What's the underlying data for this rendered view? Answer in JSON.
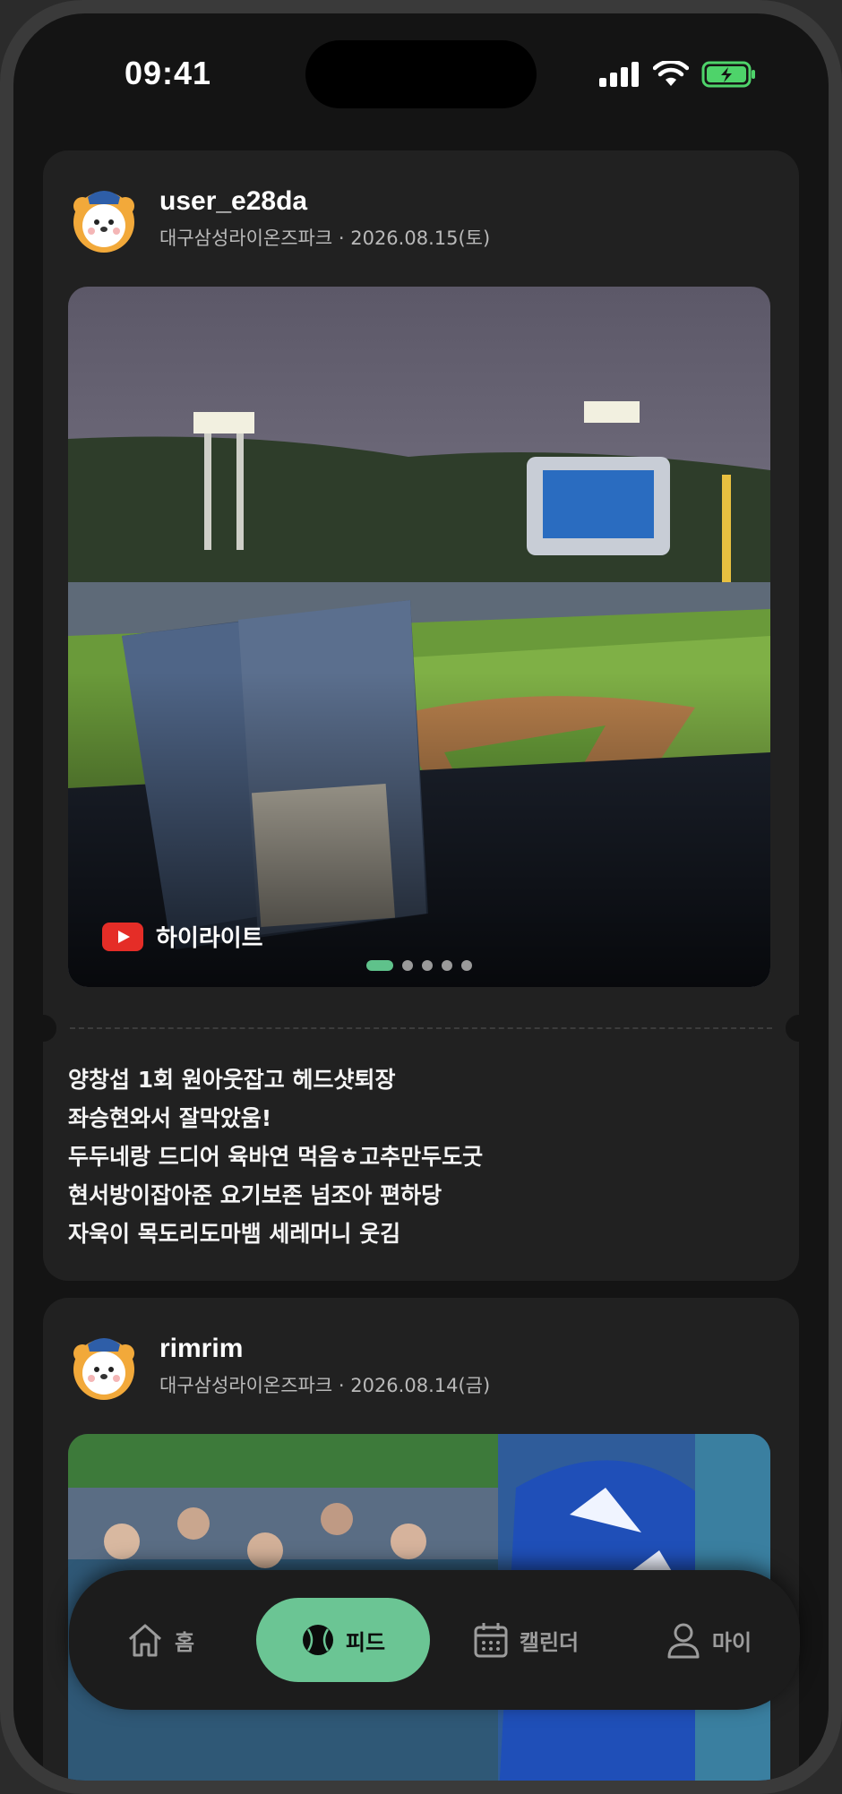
{
  "status": {
    "time": "09:41"
  },
  "posts": [
    {
      "user": "user_e28da",
      "meta": "대구삼성라이온즈파크 · 2026.08.15(토)",
      "media_badge": "하이라이트",
      "carousel": {
        "count": 5,
        "active_index": 0
      },
      "text_lines": [
        "양창섭 1회 원아웃잡고  헤드샷퇴장",
        "좌승현와서 잘막았움!",
        "두두네랑 드디어 육바연 먹음ㅎ고추만두도굿",
        "현서방이잡아준 요기보존  넘조아 편하당",
        "자욱이 목도리도마뱀 세레머니  웃김"
      ]
    },
    {
      "user": "rimrim",
      "meta": "대구삼성라이온즈파크 · 2026.08.14(금)"
    }
  ],
  "nav": {
    "items": [
      {
        "label": "홈",
        "icon": "home-icon"
      },
      {
        "label": "피드",
        "icon": "baseball-icon"
      },
      {
        "label": "캘린더",
        "icon": "calendar-icon"
      },
      {
        "label": "마이",
        "icon": "person-icon"
      }
    ],
    "active_index": 1
  },
  "colors": {
    "accent": "#6bc594",
    "battery": "#4ed36a",
    "youtube": "#e52d27"
  }
}
